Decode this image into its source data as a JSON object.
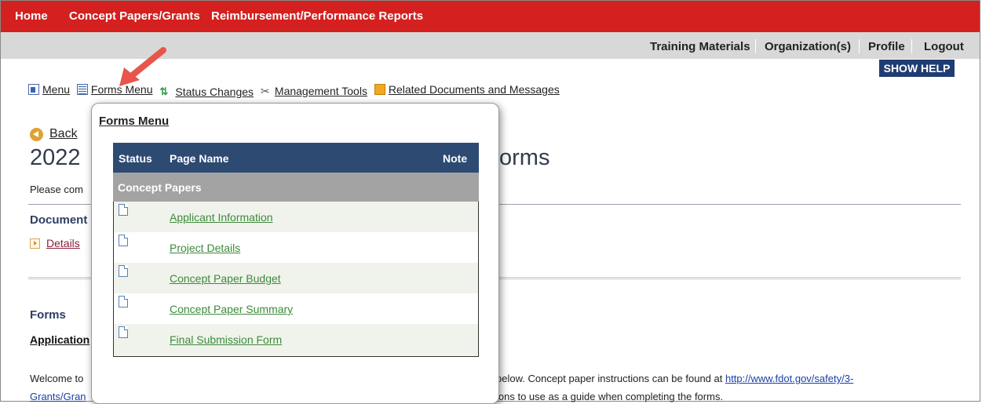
{
  "top_nav": [
    "Home",
    "Concept Papers/Grants",
    "Reimbursement/Performance Reports"
  ],
  "sub_nav": {
    "training": "Training Materials",
    "organizations": "Organization(s)",
    "profile": "Profile",
    "logout": "Logout"
  },
  "show_help": "SHOW HELP",
  "toolbar": {
    "menu": "Menu",
    "forms_menu": "Forms Menu",
    "status_changes": "Status Changes",
    "management_tools": "Management Tools",
    "related_docs": "Related Documents and Messages"
  },
  "page": {
    "back": "Back",
    "title_left": "2022",
    "title_right": "orms",
    "instructions": "Please com",
    "documents_label": "Document",
    "details_link": "Details",
    "forms_label": "Forms",
    "application_label": "Application",
    "welcome_left": "Welcome to",
    "welcome_right_text": "below. Concept paper instructions can be found at ",
    "welcome_right_link": "http://www.fdot.gov/safety/3-",
    "grants_left": "Grants/Gran",
    "grants_right": "ions to use as a guide when completing the forms."
  },
  "forms_menu": {
    "title": "Forms Menu",
    "headers": {
      "status": "Status",
      "page_name": "Page Name",
      "note": "Note"
    },
    "section": "Concept Papers",
    "rows": [
      "Applicant Information",
      "Project Details",
      "Concept Paper Budget",
      "Concept Paper Summary",
      "Final Submission Form"
    ]
  },
  "colors": {
    "top_nav_bg": "#d4201f",
    "sub_nav_bg": "#d8d8d8",
    "help_button": "#1f3d73",
    "table_header": "#2d4a73",
    "link_green": "#3d8a3a",
    "arrow": "#e8554a"
  }
}
